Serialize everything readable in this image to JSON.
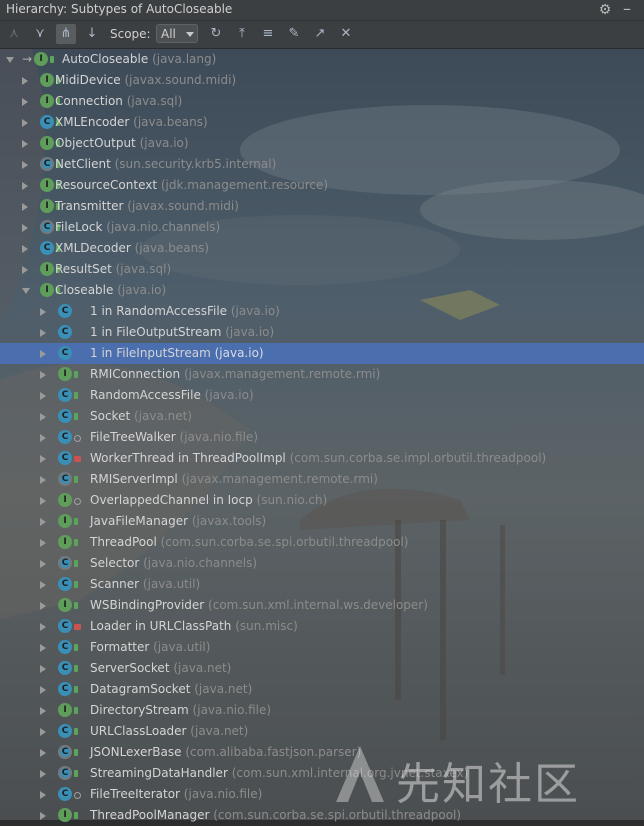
{
  "window": {
    "title": "Hierarchy:  Subtypes of AutoCloseable"
  },
  "toolbar": {
    "scope_label": "Scope:",
    "scope_value": "All"
  },
  "tree": {
    "root": {
      "name": "AutoCloseable",
      "pkg": " (java.lang)"
    },
    "rows": [
      {
        "name": "MidiDevice",
        "pkg": " (javax.sound.midi)",
        "kind": "iface",
        "mod": "pub",
        "level": 1,
        "expanded": false
      },
      {
        "name": "Connection",
        "pkg": " (java.sql)",
        "kind": "iface",
        "mod": "pub",
        "level": 1,
        "expanded": false
      },
      {
        "name": "XMLEncoder",
        "pkg": " (java.beans)",
        "kind": "cls",
        "mod": "pub",
        "level": 1,
        "expanded": false
      },
      {
        "name": "ObjectOutput",
        "pkg": " (java.io)",
        "kind": "iface",
        "mod": "pub",
        "level": 1,
        "expanded": false
      },
      {
        "name": "NetClient",
        "pkg": " (sun.security.krb5.internal)",
        "kind": "abs",
        "mod": "pub",
        "level": 1,
        "expanded": false
      },
      {
        "name": "ResourceContext",
        "pkg": " (jdk.management.resource)",
        "kind": "iface",
        "mod": "pub",
        "level": 1,
        "expanded": false
      },
      {
        "name": "Transmitter",
        "pkg": " (javax.sound.midi)",
        "kind": "iface",
        "mod": "pub",
        "level": 1,
        "expanded": false
      },
      {
        "name": "FileLock",
        "pkg": " (java.nio.channels)",
        "kind": "abs",
        "mod": "pub",
        "level": 1,
        "expanded": false
      },
      {
        "name": "XMLDecoder",
        "pkg": " (java.beans)",
        "kind": "cls",
        "mod": "pub",
        "level": 1,
        "expanded": false
      },
      {
        "name": "ResultSet",
        "pkg": " (java.sql)",
        "kind": "iface",
        "mod": "pub",
        "level": 1,
        "expanded": false
      },
      {
        "name": "Closeable",
        "pkg": " (java.io)",
        "kind": "iface",
        "mod": "pub",
        "level": 1,
        "expanded": true
      },
      {
        "name": "1 in RandomAccessFile",
        "pkg": " (java.io)",
        "kind": "cls",
        "mod": "none",
        "level": 2,
        "expanded": false
      },
      {
        "name": "1 in FileOutputStream",
        "pkg": " (java.io)",
        "kind": "cls",
        "mod": "none",
        "level": 2,
        "expanded": false
      },
      {
        "name": "1 in FileInputStream",
        "pkg": " (java.io)",
        "kind": "cls",
        "mod": "none",
        "level": 2,
        "expanded": false,
        "selected": true
      },
      {
        "name": "RMIConnection",
        "pkg": " (javax.management.remote.rmi)",
        "kind": "iface",
        "mod": "pub",
        "level": 2,
        "expanded": false
      },
      {
        "name": "RandomAccessFile",
        "pkg": " (java.io)",
        "kind": "cls",
        "mod": "pub",
        "level": 2,
        "expanded": false
      },
      {
        "name": "Socket",
        "pkg": " (java.net)",
        "kind": "cls",
        "mod": "pub",
        "level": 2,
        "expanded": false
      },
      {
        "name": "FileTreeWalker",
        "pkg": " (java.nio.file)",
        "kind": "cls",
        "mod": "pkgp",
        "level": 2,
        "expanded": false
      },
      {
        "name": "WorkerThread in ThreadPoolImpl",
        "pkg": " (com.sun.corba.se.impl.orbutil.threadpool)",
        "kind": "cls",
        "mod": "priv",
        "level": 2,
        "expanded": false
      },
      {
        "name": "RMIServerImpl",
        "pkg": " (javax.management.remote.rmi)",
        "kind": "abs",
        "mod": "pub",
        "level": 2,
        "expanded": false
      },
      {
        "name": "OverlappedChannel in Iocp",
        "pkg": " (sun.nio.ch)",
        "kind": "iface",
        "mod": "pkgp",
        "level": 2,
        "expanded": false
      },
      {
        "name": "JavaFileManager",
        "pkg": " (javax.tools)",
        "kind": "iface",
        "mod": "pub",
        "level": 2,
        "expanded": false
      },
      {
        "name": "ThreadPool",
        "pkg": " (com.sun.corba.se.spi.orbutil.threadpool)",
        "kind": "iface",
        "mod": "pub",
        "level": 2,
        "expanded": false
      },
      {
        "name": "Selector",
        "pkg": " (java.nio.channels)",
        "kind": "abs",
        "mod": "pub",
        "level": 2,
        "expanded": false
      },
      {
        "name": "Scanner",
        "pkg": " (java.util)",
        "kind": "cls",
        "mod": "pub",
        "level": 2,
        "expanded": false
      },
      {
        "name": "WSBindingProvider",
        "pkg": " (com.sun.xml.internal.ws.developer)",
        "kind": "iface",
        "mod": "pub",
        "level": 2,
        "expanded": false
      },
      {
        "name": "Loader in URLClassPath",
        "pkg": " (sun.misc)",
        "kind": "cls",
        "mod": "priv",
        "level": 2,
        "expanded": false
      },
      {
        "name": "Formatter",
        "pkg": " (java.util)",
        "kind": "cls",
        "mod": "pub",
        "level": 2,
        "expanded": false
      },
      {
        "name": "ServerSocket",
        "pkg": " (java.net)",
        "kind": "cls",
        "mod": "pub",
        "level": 2,
        "expanded": false
      },
      {
        "name": "DatagramSocket",
        "pkg": " (java.net)",
        "kind": "cls",
        "mod": "pub",
        "level": 2,
        "expanded": false
      },
      {
        "name": "DirectoryStream",
        "pkg": " (java.nio.file)",
        "kind": "iface",
        "mod": "pub",
        "level": 2,
        "expanded": false
      },
      {
        "name": "URLClassLoader",
        "pkg": " (java.net)",
        "kind": "cls",
        "mod": "pub",
        "level": 2,
        "expanded": false
      },
      {
        "name": "JSONLexerBase",
        "pkg": " (com.alibaba.fastjson.parser)",
        "kind": "abs",
        "mod": "pub",
        "level": 2,
        "expanded": false
      },
      {
        "name": "StreamingDataHandler",
        "pkg": " (com.sun.xml.internal.org.jvnet.staxex)",
        "kind": "abs",
        "mod": "pub",
        "level": 2,
        "expanded": false
      },
      {
        "name": "FileTreeIterator",
        "pkg": " (java.nio.file)",
        "kind": "cls",
        "mod": "pkgp",
        "level": 2,
        "expanded": false
      },
      {
        "name": "ThreadPoolManager",
        "pkg": " (com.sun.corba.se.spi.orbutil.threadpool)",
        "kind": "iface",
        "mod": "pub",
        "level": 2,
        "expanded": false
      }
    ]
  },
  "watermark": {
    "text": "先知社区"
  }
}
